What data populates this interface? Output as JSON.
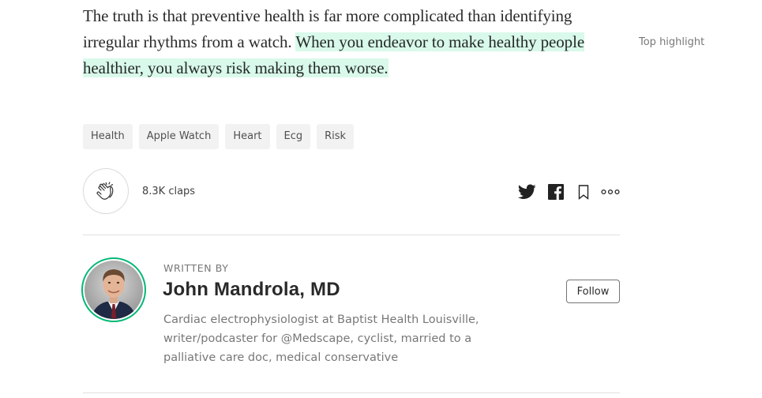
{
  "article": {
    "paragraph_plain": "The truth is that preventive health is far more complicated than identifying irregular rhythms from a watch. ",
    "paragraph_highlighted": "When you endeavor to make healthy people healthier, you always risk making them worse.",
    "top_highlight_label": "Top highlight",
    "highlight_color": "#d9f9ea"
  },
  "tags": [
    "Health",
    "Apple Watch",
    "Heart",
    "Ecg",
    "Risk"
  ],
  "actions": {
    "claps_label": "8.3K claps",
    "share_icons": [
      "twitter-icon",
      "facebook-icon",
      "bookmark-icon",
      "more-icon"
    ]
  },
  "author": {
    "written_by_label": "WRITTEN BY",
    "name": "John Mandrola, MD",
    "follow_label": "Follow",
    "bio": "Cardiac electrophysiologist at Baptist Health Louisville, writer/podcaster for @Medscape, cyclist, married to a palliative care doc, medical conservative",
    "ring_color": "#02b875"
  }
}
